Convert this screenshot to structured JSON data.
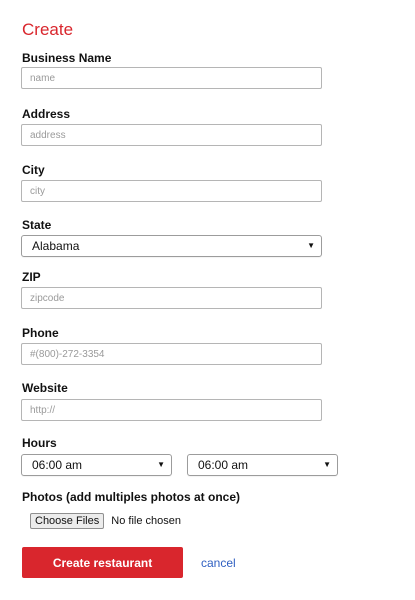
{
  "form": {
    "title": "Create",
    "business_name": {
      "label": "Business Name",
      "placeholder": "name",
      "value": ""
    },
    "address": {
      "label": "Address",
      "placeholder": "address",
      "value": ""
    },
    "city": {
      "label": "City",
      "placeholder": "city",
      "value": ""
    },
    "state": {
      "label": "State",
      "selected": "Alabama"
    },
    "zip": {
      "label": "ZIP",
      "placeholder": "zipcode",
      "value": ""
    },
    "phone": {
      "label": "Phone",
      "placeholder": "#(800)-272-3354",
      "value": ""
    },
    "website": {
      "label": "Website",
      "placeholder": "http://",
      "value": ""
    },
    "hours": {
      "label": "Hours",
      "open": "06:00 am",
      "close": "06:00 am"
    },
    "photos": {
      "label": "Photos (add multiples photos at once)",
      "button": "Choose Files",
      "status": "No file chosen"
    },
    "submit_label": "Create restaurant",
    "cancel_label": "cancel"
  },
  "colors": {
    "accent": "#d9262d",
    "link": "#2f5fc1"
  },
  "icons": {
    "select_arrow": "dropdown-arrow-icon"
  }
}
